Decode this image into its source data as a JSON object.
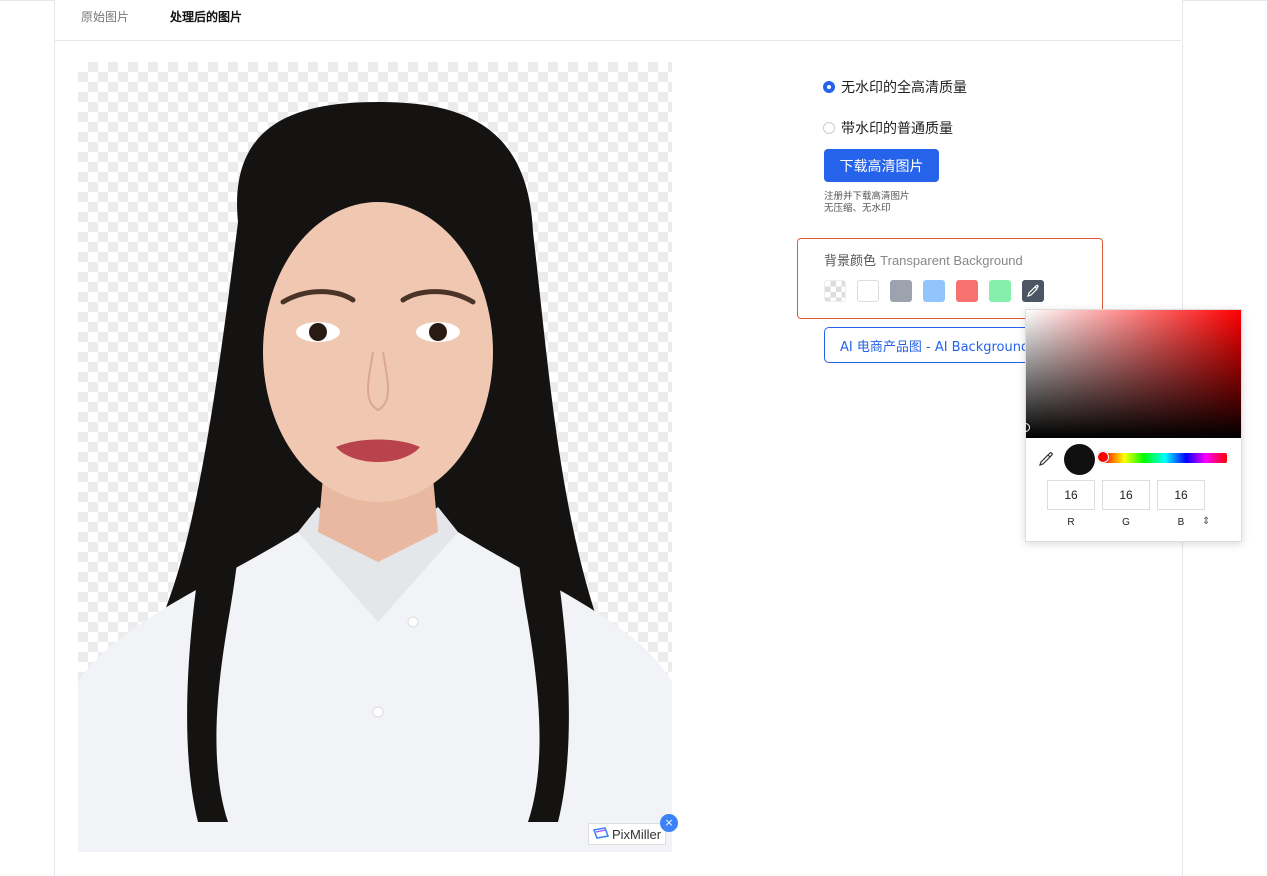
{
  "tabs": {
    "original": "原始图片",
    "processed": "处理后的图片"
  },
  "image": {
    "watermark_text": "PixMiller",
    "watermark_close": "×"
  },
  "quality": {
    "option_hd": "无水印的全高清质量",
    "option_normal": "带水印的普通质量",
    "selected": "hd"
  },
  "download": {
    "button": "下载高清图片",
    "note_line1": "注册并下载高清图片",
    "note_line2": "无压缩、无水印"
  },
  "background": {
    "label": "背景颜色",
    "value": "Transparent Background",
    "swatches": [
      {
        "name": "transparent",
        "color": "transparent"
      },
      {
        "name": "white",
        "color": "#ffffff"
      },
      {
        "name": "gray",
        "color": "#9ca3af"
      },
      {
        "name": "blue",
        "color": "#93c5fd"
      },
      {
        "name": "red",
        "color": "#f87171"
      },
      {
        "name": "green",
        "color": "#86efac"
      },
      {
        "name": "custom-picker",
        "color": "#4b5563"
      }
    ]
  },
  "ai_button": "AI 电商产品图 - AI Background",
  "color_picker": {
    "preview_color": "#101010",
    "r": "16",
    "g": "16",
    "b": "16",
    "labels": {
      "r": "R",
      "g": "G",
      "b": "B"
    },
    "mode_toggle": "⇕"
  },
  "colors": {
    "accent": "#2563eb",
    "highlight_border": "#e25a3c"
  }
}
